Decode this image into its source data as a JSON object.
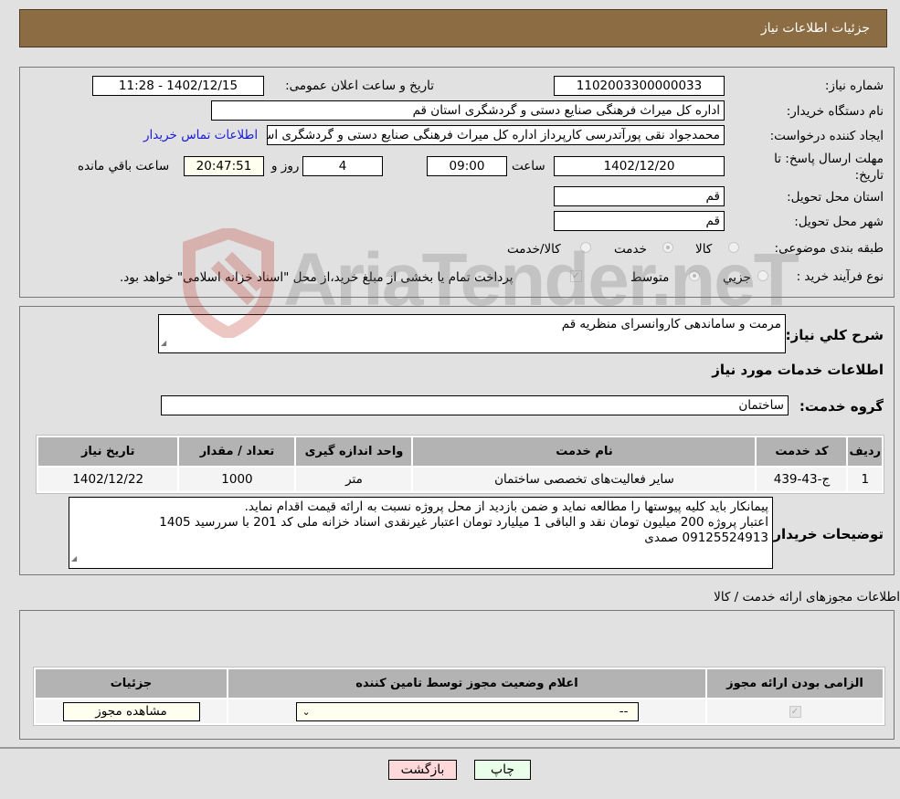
{
  "header": {
    "title": "جزئیات اطلاعات نیاز"
  },
  "form": {
    "need_number_label": "شماره نیاز:",
    "need_number": "1102003300000033",
    "announce_label": "تاریخ و ساعت اعلان عمومی:",
    "announce_value": "1402/12/15 - 11:28",
    "buyer_org_label": "نام دستگاه خریدار:",
    "buyer_org": "اداره کل میراث فرهنگی  صنایع دستی و گردشگری استان قم",
    "creator_label": "ایجاد کننده درخواست:",
    "creator": "محمدجواد نقی پورآتدرسی کارپرداز اداره کل میراث فرهنگی  صنایع دستی و گردشگری استان قم",
    "contact_link": "اطلاعات تماس خریدار",
    "deadline_label": "مهلت ارسال پاسخ: تا تاریخ:",
    "deadline_date": "1402/12/20",
    "time_label": "ساعت",
    "deadline_time": "09:00",
    "days_value": "4",
    "days_label": "روز و",
    "remaining_time": "20:47:51",
    "remaining_label": "ساعت باقي مانده",
    "province_label": "استان محل تحویل:",
    "province": "قم",
    "city_label": "شهر محل تحویل:",
    "city": "قم",
    "category_label": "طبقه بندی موضوعی:",
    "category_options": [
      {
        "label": "کالا",
        "checked": false
      },
      {
        "label": "خدمت",
        "checked": true
      },
      {
        "label": "کالا/خدمت",
        "checked": false
      }
    ],
    "process_label": "نوع فرآیند خرید :",
    "process_options": [
      {
        "label": "جزيي",
        "checked": false
      },
      {
        "label": "متوسط",
        "checked": true
      }
    ],
    "treasury_checkbox_checked": true,
    "treasury_note": "پرداخت تمام یا بخشی از مبلغ خرید،از محل \"اسناد خزانه اسلامی\" خواهد بود."
  },
  "description": {
    "label": "شرح کلي نیاز:",
    "value": "مرمت و ساماندهی کاروانسرای منظریه قم",
    "services_heading": "اطلاعات خدمات مورد نیاز",
    "service_group_label": "گروه خدمت:",
    "service_group": "ساختمان"
  },
  "services_table": {
    "headers": [
      "ردیف",
      "کد خدمت",
      "نام خدمت",
      "واحد اندازه گیری",
      "تعداد / مقدار",
      "تاریخ نیاز"
    ],
    "rows": [
      [
        "1",
        "ج-43-439",
        "سایر فعالیت‌های تخصصی ساختمان",
        "متر",
        "1000",
        "1402/12/22"
      ]
    ]
  },
  "buyer_notes": {
    "label": "توضیحات خریدار:",
    "lines": [
      "پیمانکار باید کلیه پیوستها را مطالعه نماید و ضمن بازدید از محل پروژه نسبت به ارائه قیمت اقدام نماید.",
      "اعتبار پروژه 200 میلیون تومان نقد و الباقی 1 میلیارد تومان اعتبار غیرنقدی اسناد خزانه ملی کد 201 با سررسید 1405",
      "09125524913 صمدی"
    ]
  },
  "permits": {
    "title": "اطلاعات مجوزهای ارائه خدمت / کالا",
    "headers": [
      "الزامی بودن ارائه مجوز",
      "اعلام وضعیت مجوز توسط تامین کننده",
      "جزئیات"
    ],
    "row": {
      "required_checked": true,
      "status_select": "--",
      "details_button": "مشاهده مجوز"
    }
  },
  "footer": {
    "print_button": "چاپ",
    "back_button": "بازگشت"
  },
  "watermark": {
    "text": "AriaTender.neT"
  },
  "colors": {
    "header_bg": "#8b6c43",
    "back_button_bg": "#ffd9d9",
    "print_button_bg": "#eaffea",
    "link": "#1a1ad6"
  }
}
